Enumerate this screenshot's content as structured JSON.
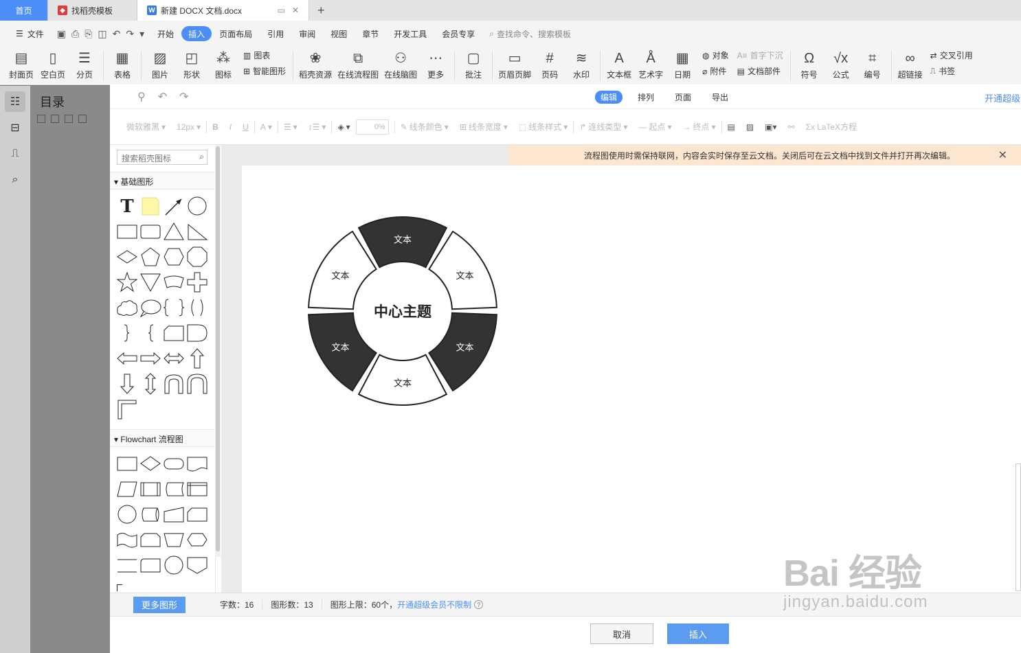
{
  "tabs": {
    "home": "首页",
    "templates": "找稻壳模板",
    "doc": "新建 DOCX 文档.docx",
    "new_tab": "+"
  },
  "menu": {
    "file": "文件",
    "items": [
      "开始",
      "插入",
      "页面布局",
      "引用",
      "审阅",
      "视图",
      "章节",
      "开发工具",
      "会员专享"
    ],
    "selected": "插入",
    "search": "查找命令、搜索模板"
  },
  "ribbon": {
    "cover": "封面页",
    "blank": "空白页",
    "break": "分页",
    "table": "表格",
    "picture": "图片",
    "shape": "形状",
    "icon": "图标",
    "chart": "图表",
    "smartart": "智能图形",
    "docer": "稻壳资源",
    "flowchart": "在线流程图",
    "mindmap": "在线脑图",
    "more": "更多",
    "comment": "批注",
    "header": "页眉页脚",
    "pagenum": "页码",
    "watermark": "水印",
    "textbox": "文本框",
    "wordart": "艺术字",
    "date": "日期",
    "object": "对象",
    "attach": "附件",
    "dropcap": "首字下沉",
    "docpart": "文档部件",
    "symbol": "符号",
    "formula": "公式",
    "number": "编号",
    "hyperlink": "超链接",
    "crossref": "交叉引用",
    "bookmark": "书签"
  },
  "toc": {
    "title": "目录"
  },
  "dialog": {
    "tabs": [
      "编辑",
      "排列",
      "页面",
      "导出"
    ],
    "active_tab": "编辑",
    "vip": "开通超级会",
    "toolbar": {
      "font": "微软雅黑",
      "size": "12px",
      "bold": "B",
      "italic": "I",
      "underline": "U",
      "fontcolor": "A",
      "opacity": "0%",
      "line_color": "线条颜色",
      "line_width": "线条宽度",
      "line_style": "线条样式",
      "connector": "连线类型",
      "start": "起点",
      "end": "终点",
      "latex": "LaTeX方程"
    },
    "panel": {
      "search_placeholder": "搜索稻壳图标",
      "section_basic": "基础图形",
      "section_flow": "Flowchart 流程图"
    },
    "notice": "流程图使用时需保持联网，内容会实时保存至云文档。关闭后可在云文档中找到文件并打开再次编辑。",
    "diagram": {
      "center": "中心主题",
      "segments": [
        "文本",
        "文本",
        "文本",
        "文本",
        "文本",
        "文本"
      ],
      "dark_color": "#333333",
      "light_color": "#ffffff"
    },
    "footer": {
      "more_shapes": "更多图形",
      "word_count": "字数：16",
      "shape_count": "图形数：13",
      "shape_limit": "图形上限：60个，",
      "vip_link": "开通超级会员不限制",
      "help": "?"
    },
    "buttons": {
      "cancel": "取消",
      "insert": "插入"
    }
  },
  "watermark": {
    "brand": "Bai 经验",
    "url": "jingyan.baidu.com"
  }
}
